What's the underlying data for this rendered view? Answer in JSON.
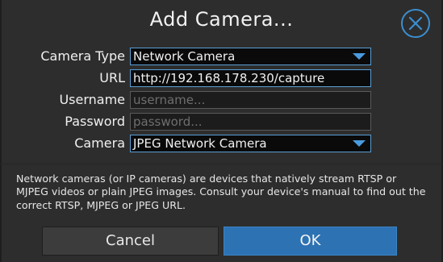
{
  "dialog": {
    "title": "Add Camera...",
    "close_icon": "close-icon"
  },
  "form": {
    "camera_type": {
      "label": "Camera Type",
      "value": "Network Camera"
    },
    "url": {
      "label": "URL",
      "value": "http://192.168.178.230/capture"
    },
    "username": {
      "label": "Username",
      "placeholder": "username..."
    },
    "password": {
      "label": "Password",
      "placeholder": "password..."
    },
    "camera": {
      "label": "Camera",
      "value": "JPEG Network Camera"
    }
  },
  "description": "Network cameras (or IP cameras) are devices that natively stream RTSP or MJPEG videos or plain JPEG images. Consult your device's manual to find out the correct RTSP, MJPEG or JPEG URL.",
  "buttons": {
    "cancel": "Cancel",
    "ok": "OK"
  },
  "colors": {
    "accent": "#3b8fd1",
    "ok_button": "#2d72b3",
    "background": "#2d2d2d"
  }
}
